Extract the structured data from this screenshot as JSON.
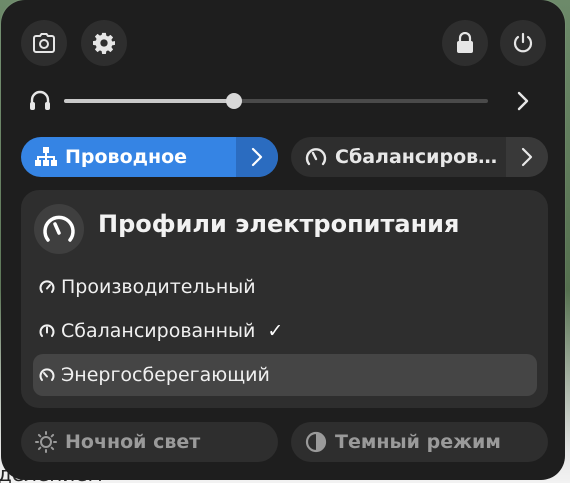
{
  "desktop": {
    "behind_text": "делением"
  },
  "top_bar": {
    "screenshot_icon": "camera-icon",
    "settings_icon": "gear-icon",
    "lock_icon": "lock-icon",
    "power_icon": "power-icon"
  },
  "volume": {
    "icon": "headphones-icon",
    "level_percent": 40,
    "arrow_icon": "chevron-right-icon"
  },
  "toggles": {
    "network": {
      "label": "Проводное",
      "icon": "wired-network-icon",
      "active": true
    },
    "power_profile": {
      "label": "Сбалансиров…",
      "icon": "speedometer-icon",
      "active": false
    }
  },
  "power_menu": {
    "title": "Профили электропитания",
    "items": [
      {
        "label": "Производительный",
        "selected": false,
        "hovered": false
      },
      {
        "label": "Сбалансированный",
        "selected": true,
        "hovered": false
      },
      {
        "label": "Энергосберегающий",
        "selected": false,
        "hovered": true
      }
    ],
    "check_mark": "✓"
  },
  "bottom": {
    "night_light": {
      "label": "Ночной свет",
      "icon": "night-light-icon"
    },
    "dark_mode": {
      "label": "Темный режим",
      "icon": "dark-mode-icon"
    }
  },
  "colors": {
    "accent": "#3584e4",
    "panel": "#1e1e1e",
    "surface": "#2e2e2e"
  }
}
